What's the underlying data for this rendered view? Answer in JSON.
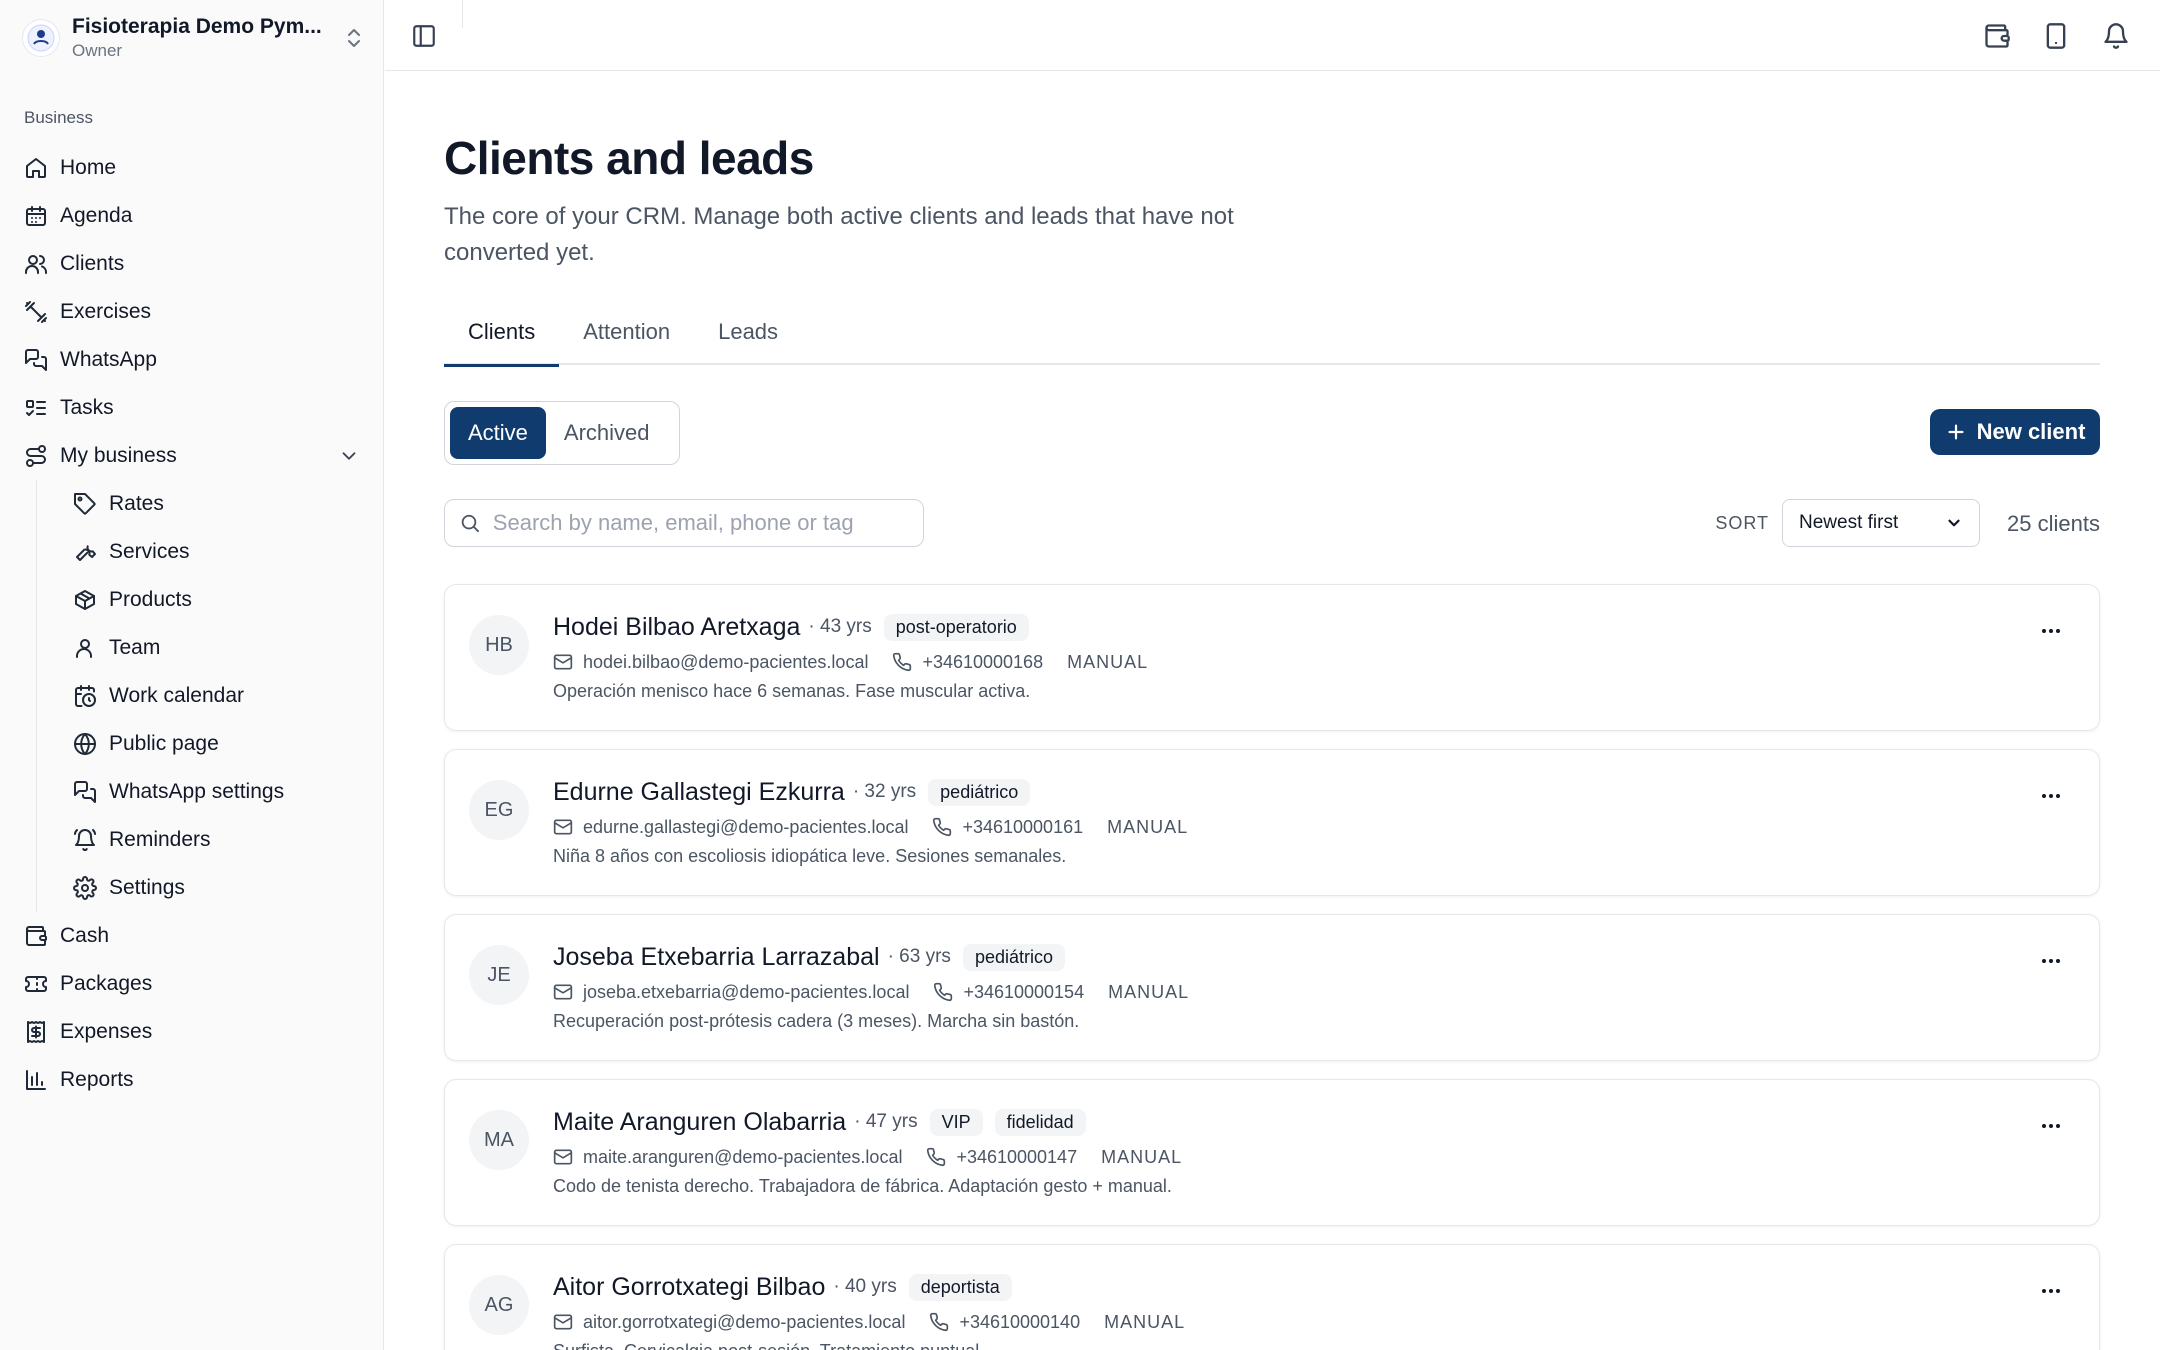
{
  "org": {
    "name": "Fisioterapia Demo Pym...",
    "role": "Owner"
  },
  "sidebar": {
    "section_label": "Business",
    "items": [
      {
        "label": "Home",
        "icon": "home-icon"
      },
      {
        "label": "Agenda",
        "icon": "calendar-icon"
      },
      {
        "label": "Clients",
        "icon": "users-icon"
      },
      {
        "label": "Exercises",
        "icon": "dumbbell-icon"
      },
      {
        "label": "WhatsApp",
        "icon": "chat-icon"
      },
      {
        "label": "Tasks",
        "icon": "list-todo-icon"
      },
      {
        "label": "My business",
        "icon": "route-icon"
      }
    ],
    "sub_items": [
      {
        "label": "Rates",
        "icon": "tag-icon"
      },
      {
        "label": "Services",
        "icon": "wrench-icon"
      },
      {
        "label": "Products",
        "icon": "package-icon"
      },
      {
        "label": "Team",
        "icon": "user-icon"
      },
      {
        "label": "Work calendar",
        "icon": "calendar-clock-icon"
      },
      {
        "label": "Public page",
        "icon": "globe-icon"
      },
      {
        "label": "WhatsApp settings",
        "icon": "chat-icon"
      },
      {
        "label": "Reminders",
        "icon": "bell-ring-icon"
      },
      {
        "label": "Settings",
        "icon": "gear-icon"
      }
    ],
    "bottom_items": [
      {
        "label": "Cash",
        "icon": "wallet-icon"
      },
      {
        "label": "Packages",
        "icon": "ticket-icon"
      },
      {
        "label": "Expenses",
        "icon": "receipt-icon"
      },
      {
        "label": "Reports",
        "icon": "bar-chart-icon"
      }
    ]
  },
  "page": {
    "title": "Clients and leads",
    "subtitle": "The core of your CRM. Manage both active clients and leads that have not converted yet."
  },
  "tabs": [
    {
      "label": "Clients",
      "active": true
    },
    {
      "label": "Attention",
      "active": false
    },
    {
      "label": "Leads",
      "active": false
    }
  ],
  "filter": {
    "active": "Active",
    "archived": "Archived"
  },
  "new_client_label": "New client",
  "search": {
    "placeholder": "Search by name, email, phone or tag",
    "value": ""
  },
  "sort": {
    "label": "SORT",
    "selected": "Newest first"
  },
  "count": "25 clients",
  "clients": [
    {
      "initials": "HB",
      "name": "Hodei Bilbao Aretxaga",
      "age": "· 43 yrs",
      "tags": [
        "post-operatorio"
      ],
      "email": "hodei.bilbao@demo-pacientes.local",
      "phone": "+34610000168",
      "source": "MANUAL",
      "note": "Operación menisco hace 6 semanas. Fase muscular activa."
    },
    {
      "initials": "EG",
      "name": "Edurne Gallastegi Ezkurra",
      "age": "· 32 yrs",
      "tags": [
        "pediátrico"
      ],
      "email": "edurne.gallastegi@demo-pacientes.local",
      "phone": "+34610000161",
      "source": "MANUAL",
      "note": "Niña 8 años con escoliosis idiopática leve. Sesiones semanales."
    },
    {
      "initials": "JE",
      "name": "Joseba Etxebarria Larrazabal",
      "age": "· 63 yrs",
      "tags": [
        "pediátrico"
      ],
      "email": "joseba.etxebarria@demo-pacientes.local",
      "phone": "+34610000154",
      "source": "MANUAL",
      "note": "Recuperación post-prótesis cadera (3 meses). Marcha sin bastón."
    },
    {
      "initials": "MA",
      "name": "Maite Aranguren Olabarria",
      "age": "· 47 yrs",
      "tags": [
        "VIP",
        "fidelidad"
      ],
      "email": "maite.aranguren@demo-pacientes.local",
      "phone": "+34610000147",
      "source": "MANUAL",
      "note": "Codo de tenista derecho. Trabajadora de fábrica. Adaptación gesto + manual."
    },
    {
      "initials": "AG",
      "name": "Aitor Gorrotxategi Bilbao",
      "age": "· 40 yrs",
      "tags": [
        "deportista"
      ],
      "email": "aitor.gorrotxategi@demo-pacientes.local",
      "phone": "+34610000140",
      "source": "MANUAL",
      "note": "Surfista. Cervicalgia post-sesión. Tratamiento puntual."
    }
  ]
}
